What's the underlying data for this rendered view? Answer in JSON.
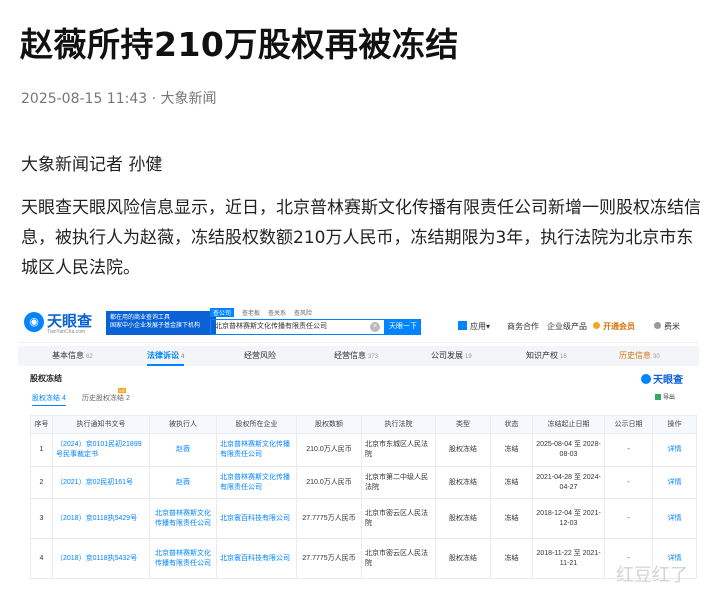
{
  "article": {
    "title": "赵薇所持210万股权再被冻结",
    "meta": "2025-08-15 11:43 · 大象新闻",
    "byline": "大象新闻记者 孙健",
    "paragraph": "天眼查天眼风险信息显示，近日，北京普林赛斯文化传播有限责任公司新增一则股权冻结信息，被执行人为赵薇，冻结股权数额210万人民币，冻结期限为3年，执行法院为北京市东城区人民法院。"
  },
  "screenshot": {
    "logo": "天眼查",
    "logo_sub": "TianYanCha.com",
    "slogan_line1": "都在用的商业查询工具",
    "slogan_line2": "国家中小企业发展子基金旗下机构",
    "search_tabs": [
      "查公司",
      "查老板",
      "查关系",
      "查风险"
    ],
    "search_value": "北京普林赛斯文化传播有限责任公司",
    "search_button": "天眼一下",
    "nav": {
      "app": "应用",
      "app_caret": "▾",
      "business": "商务合作",
      "enterprise": "企业级产品",
      "vip": "开通会员",
      "user": "费米"
    },
    "tabs": [
      {
        "label": "基本信息",
        "count": "62"
      },
      {
        "label": "法律诉讼",
        "count": "4"
      },
      {
        "label": "经营风险",
        "count": ""
      },
      {
        "label": "经营信息",
        "count": "373"
      },
      {
        "label": "公司发展",
        "count": "19"
      },
      {
        "label": "知识产权",
        "count": "16"
      },
      {
        "label": "历史信息",
        "count": "30"
      }
    ],
    "section_title": "股权冻结",
    "brand_right": "天眼查",
    "subtab_active": "股权冻结 4",
    "subtab_history": "历史股权冻结 2",
    "vip_tag": "VIP",
    "export": "导出",
    "table": {
      "headers": [
        "序号",
        "执行通知书文号",
        "被执行人",
        "股权所在企业",
        "股权数额",
        "执行法院",
        "类型",
        "状态",
        "冻结起止日期",
        "公示日期",
        "操作"
      ],
      "rows": [
        [
          "1",
          "（2024）京0101民初21899号民事裁定书",
          "赵薇",
          "北京普林赛斯文化传播有限责任公司",
          "210.0万人民币",
          "北京市东城区人民法院",
          "股权冻结",
          "冻结",
          "2025-08-04 至 2028-08-03",
          "-",
          "详情"
        ],
        [
          "2",
          "（2021）京02民初161号",
          "赵薇",
          "北京普林赛斯文化传播有限责任公司",
          "210.0万人民币",
          "北京市第二中级人民法院",
          "股权冻结",
          "冻结",
          "2021-04-28 至 2024-04-27",
          "-",
          "详情"
        ],
        [
          "3",
          "（2018）京0118执5429号",
          "北京普林赛斯文化传播有限责任公司",
          "北京寰百科技有限公司",
          "27.7775万人民币",
          "北京市密云区人民法院",
          "股权冻结",
          "冻结",
          "2018-12-04 至 2021-12-03",
          "-",
          "详情"
        ],
        [
          "4",
          "（2018）京0118执5432号",
          "北京普林赛斯文化传播有限责任公司",
          "北京寰百科技有限公司",
          "27.7775万人民币",
          "北京市密云区人民法院",
          "股权冻结",
          "冻结",
          "2018-11-22 至 2021-11-21",
          "-",
          "详情"
        ]
      ]
    }
  },
  "watermark": "红豆红了"
}
